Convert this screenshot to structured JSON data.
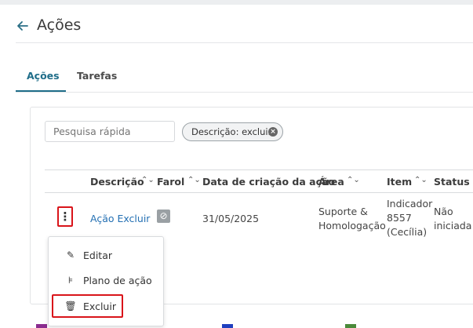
{
  "header": {
    "title": "Ações"
  },
  "tabs": [
    {
      "label": "Ações",
      "active": true
    },
    {
      "label": "Tarefas",
      "active": false
    }
  ],
  "search": {
    "placeholder": "Pesquisa rápida",
    "value": ""
  },
  "filter_chip": {
    "label": "Descrição: excluir"
  },
  "table": {
    "columns": [
      "Descrição",
      "Farol",
      "Data de criação da ação",
      "Área",
      "Item",
      "Status"
    ],
    "row": {
      "descricao": "Ação Excluir",
      "farol_icon": "cancel-circle-icon",
      "data": "31/05/2025",
      "area_line1": "Suporte &",
      "area_line2": "Homologação",
      "item_line1": "Indicador",
      "item_line2": "8557",
      "item_line3": "(Cecília)",
      "status_line1": "Não",
      "status_line2": "iniciada"
    }
  },
  "row_menu": {
    "items": [
      {
        "label": "Editar",
        "icon": "pencil-icon"
      },
      {
        "label": "Plano de ação",
        "icon": "plan-icon"
      },
      {
        "label": "Excluir",
        "icon": "trash-icon"
      }
    ]
  },
  "legend": [
    {
      "color": "#8a2c8f"
    },
    {
      "color": "#1f3fbf"
    },
    {
      "color": "#4a8a3a"
    }
  ],
  "colors": {
    "accent": "#1f6d89",
    "link": "#2470b3",
    "highlight": "#d9141a"
  }
}
